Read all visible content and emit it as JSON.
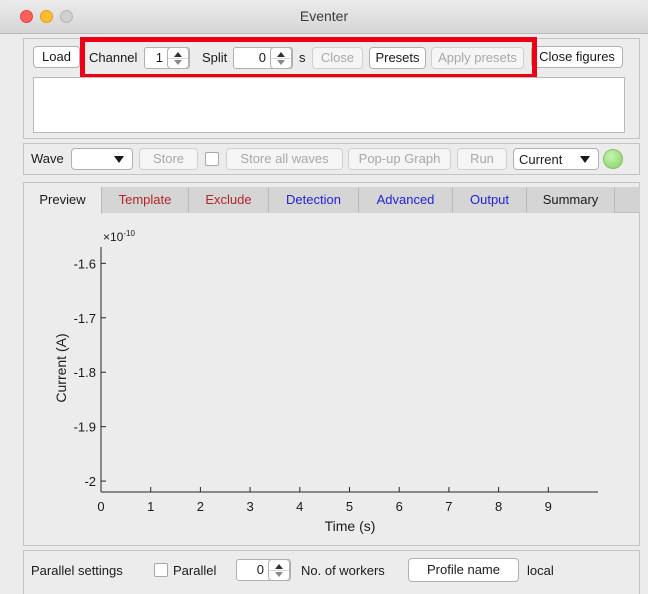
{
  "window": {
    "title": "Eventer"
  },
  "top": {
    "load_label": "Load",
    "channel_label": "Channel",
    "channel_value": "1",
    "split_label": "Split",
    "split_value": "0",
    "split_unit": "s",
    "close_label": "Close",
    "presets_label": "Presets",
    "apply_presets_label": "Apply presets",
    "close_figures_label": "Close figures",
    "highlight_color": "#f00015"
  },
  "wave": {
    "wave_label": "Wave",
    "wave_select_value": "",
    "store_label": "Store",
    "store_all_label": "Store all waves",
    "popup_label": "Pop-up Graph",
    "run_label": "Run",
    "mode_value": "Current",
    "status_color": "#7ed35a"
  },
  "tabs": [
    {
      "label": "Preview",
      "color": "#1a1a1a"
    },
    {
      "label": "Template",
      "color": "#b0262b"
    },
    {
      "label": "Exclude",
      "color": "#b0262b"
    },
    {
      "label": "Detection",
      "color": "#2323d6"
    },
    {
      "label": "Advanced",
      "color": "#2323d6"
    },
    {
      "label": "Output",
      "color": "#2323d6"
    },
    {
      "label": "Summary",
      "color": "#1a1a1a"
    }
  ],
  "chart_data": {
    "type": "line",
    "xlabel": "Time (s)",
    "ylabel": "Current (A)",
    "y_exponent_label": "×10",
    "y_exponent_power": "-10",
    "x_ticks": [
      "0",
      "1",
      "2",
      "3",
      "4",
      "5",
      "6",
      "7",
      "8",
      "9"
    ],
    "y_ticks": [
      "-1.6",
      "-1.7",
      "-1.8",
      "-1.9",
      "-2"
    ],
    "xlim": [
      0,
      10
    ],
    "ylim": [
      -2.02,
      -1.57
    ],
    "series": []
  },
  "parallel": {
    "settings_label": "Parallel settings",
    "parallel_label": "Parallel",
    "workers_value": "0",
    "workers_label": "No. of workers",
    "profile_button_label": "Profile name",
    "profile_value": "local"
  }
}
